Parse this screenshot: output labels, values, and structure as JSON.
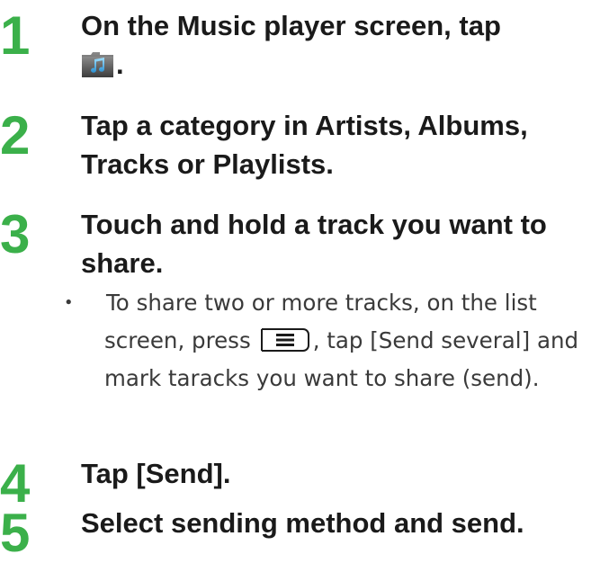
{
  "steps": [
    {
      "number": "1",
      "text_before_icon": "On the Music player screen, tap",
      "icon": "music-note-icon",
      "text_after_icon": "."
    },
    {
      "number": "2",
      "text": "Tap a category in Artists, Albums, Tracks or Playlists."
    },
    {
      "number": "3",
      "text": "Touch and hold a track you want to share.",
      "note": {
        "bullet": "・",
        "text_before_key": "To share two or more tracks, on the list screen, press",
        "key_icon": "menu-key-icon",
        "text_after_key": ", tap [Send several] and mark taracks you want to share (send)."
      }
    },
    {
      "number": "4",
      "text": "Tap [Send]."
    },
    {
      "number": "5",
      "text": "Select sending method and send."
    }
  ],
  "colors": {
    "step_number": "#3bb04a",
    "step_text": "#1a1a1a",
    "note_text": "#3a3a3a"
  }
}
